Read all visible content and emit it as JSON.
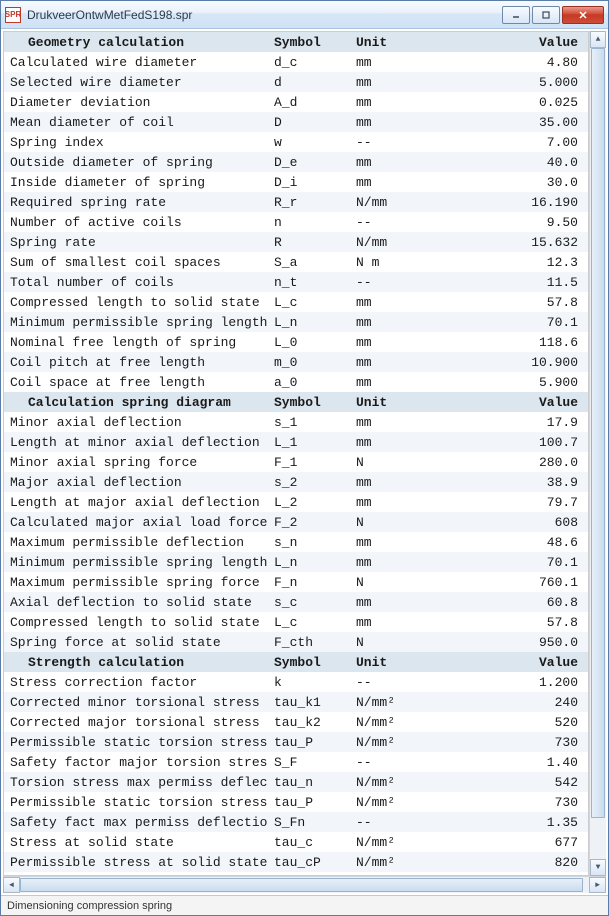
{
  "window": {
    "title": "DrukveerOntwMetFedS198.spr",
    "app_icon_text": "SPR"
  },
  "columns": {
    "c1": "Symbol",
    "c2": "Unit",
    "c3": "Value"
  },
  "sections": [
    {
      "title": "Geometry calculation",
      "rows": [
        {
          "desc": "Calculated wire diameter",
          "sym": "d_c",
          "unit": "mm",
          "val": "4.80"
        },
        {
          "desc": "Selected wire diameter",
          "sym": "d",
          "unit": "mm",
          "val": "5.000"
        },
        {
          "desc": "Diameter deviation",
          "sym": "A_d",
          "unit": "mm",
          "val": "0.025"
        },
        {
          "desc": "Mean diameter of coil",
          "sym": "D",
          "unit": "mm",
          "val": "35.00"
        },
        {
          "desc": "Spring index",
          "sym": "w",
          "unit": "--",
          "val": "7.00"
        },
        {
          "desc": "Outside diameter of spring",
          "sym": "D_e",
          "unit": "mm",
          "val": "40.0"
        },
        {
          "desc": "Inside diameter of spring",
          "sym": "D_i",
          "unit": "mm",
          "val": "30.0"
        },
        {
          "desc": "Required spring rate",
          "sym": "R_r",
          "unit": "N/mm",
          "val": "16.190"
        },
        {
          "desc": "Number of active coils",
          "sym": "n",
          "unit": "--",
          "val": "9.50"
        },
        {
          "desc": "Spring rate",
          "sym": "R",
          "unit": "N/mm",
          "val": "15.632"
        },
        {
          "desc": "Sum of smallest coil spaces",
          "sym": "S_a",
          "unit": "N m",
          "val": "12.3"
        },
        {
          "desc": "Total number of coils",
          "sym": "n_t",
          "unit": "--",
          "val": "11.5"
        },
        {
          "desc": "Compressed length to solid state",
          "sym": "L_c",
          "unit": "mm",
          "val": "57.8"
        },
        {
          "desc": "Minimum permissible spring length",
          "sym": "L_n",
          "unit": "mm",
          "val": "70.1"
        },
        {
          "desc": "Nominal free length of spring",
          "sym": "L_0",
          "unit": "mm",
          "val": "118.6"
        },
        {
          "desc": "Coil pitch at free length",
          "sym": "m_0",
          "unit": "mm",
          "val": "10.900"
        },
        {
          "desc": "Coil space at free length",
          "sym": "a_0",
          "unit": "mm",
          "val": "5.900"
        }
      ]
    },
    {
      "title": "Calculation spring diagram",
      "rows": [
        {
          "desc": "Minor axial deflection",
          "sym": "s_1",
          "unit": "mm",
          "val": "17.9"
        },
        {
          "desc": "Length at minor axial deflection",
          "sym": "L_1",
          "unit": "mm",
          "val": "100.7"
        },
        {
          "desc": "Minor axial spring force",
          "sym": "F_1",
          "unit": "N",
          "val": "280.0"
        },
        {
          "desc": "Major axial deflection",
          "sym": "s_2",
          "unit": "mm",
          "val": "38.9"
        },
        {
          "desc": "Length at major axial deflection",
          "sym": "L_2",
          "unit": "mm",
          "val": "79.7"
        },
        {
          "desc": "Calculated major axial load force",
          "sym": "F_2",
          "unit": "N",
          "val": "608"
        },
        {
          "desc": "Maximum permissible deflection",
          "sym": "s_n",
          "unit": "mm",
          "val": "48.6"
        },
        {
          "desc": "Minimum permissible spring length",
          "sym": "L_n",
          "unit": "mm",
          "val": "70.1"
        },
        {
          "desc": "Maximum permissible spring force",
          "sym": "F_n",
          "unit": "N",
          "val": "760.1"
        },
        {
          "desc": "Axial deflection to solid state",
          "sym": "s_c",
          "unit": "mm",
          "val": "60.8"
        },
        {
          "desc": "Compressed length to solid state",
          "sym": "L_c",
          "unit": "mm",
          "val": "57.8"
        },
        {
          "desc": "Spring force at solid state",
          "sym": "F_cth",
          "unit": "N",
          "val": "950.0"
        }
      ]
    },
    {
      "title": "Strength calculation",
      "rows": [
        {
          "desc": "Stress correction factor",
          "sym": "k",
          "unit": "--",
          "val": "1.200"
        },
        {
          "desc": "Corrected minor torsional stress",
          "sym": "tau_k1",
          "unit": "N/mm²",
          "val": "240"
        },
        {
          "desc": "Corrected major torsional stress",
          "sym": "tau_k2",
          "unit": "N/mm²",
          "val": "520"
        },
        {
          "desc": "Permissible static torsion stress",
          "sym": "tau_P",
          "unit": "N/mm²",
          "val": "730"
        },
        {
          "desc": "Safety factor major torsion stress",
          "sym": "S_F",
          "unit": "--",
          "val": "1.40"
        },
        {
          "desc": "Torsion stress max permiss deflect",
          "sym": "tau_n",
          "unit": "N/mm²",
          "val": "542"
        },
        {
          "desc": "Permissible static torsion stress",
          "sym": "tau_P",
          "unit": "N/mm²",
          "val": "730"
        },
        {
          "desc": "Safety fact max permiss deflection",
          "sym": "S_Fn",
          "unit": "--",
          "val": "1.35"
        },
        {
          "desc": "Stress at solid state",
          "sym": "tau_c",
          "unit": "N/mm²",
          "val": "677"
        },
        {
          "desc": "Permissible stress at solid state",
          "sym": "tau_cP",
          "unit": "N/mm²",
          "val": "820"
        }
      ]
    }
  ],
  "statusbar": {
    "text": "Dimensioning compression spring"
  }
}
